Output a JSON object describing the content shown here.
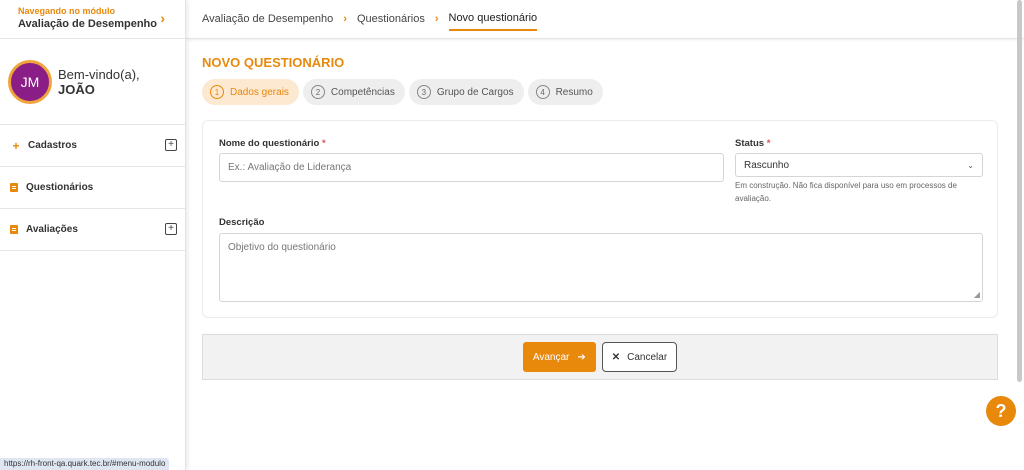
{
  "sidebar": {
    "module_small": "Navegando no módulo",
    "module_name": "Avaliação de Desempenho",
    "avatar_initials": "JM",
    "welcome": "Bem-vindo(a),",
    "user_name": "JOÃO",
    "items": [
      {
        "label": "Cadastros",
        "icon": "plus-icon",
        "expandable": true
      },
      {
        "label": "Questionários",
        "icon": "document-icon",
        "expandable": false
      },
      {
        "label": "Avaliações",
        "icon": "clipboard-icon",
        "expandable": true
      }
    ]
  },
  "status_url": "https://rh-front-qa.quark.tec.br/#menu-modulo",
  "breadcrumb": [
    "Avaliação de Desempenho",
    "Questionários",
    "Novo questionário"
  ],
  "page_title": "NOVO QUESTIONÁRIO",
  "steps": [
    {
      "num": "1",
      "label": "Dados gerais",
      "active": true
    },
    {
      "num": "2",
      "label": "Competências",
      "active": false
    },
    {
      "num": "3",
      "label": "Grupo de Cargos",
      "active": false
    },
    {
      "num": "4",
      "label": "Resumo",
      "active": false
    }
  ],
  "form": {
    "name_label": "Nome do questionário",
    "name_placeholder": "Ex.: Avaliação de Liderança",
    "status_label": "Status",
    "status_value": "Rascunho",
    "status_hint": "Em construção. Não fica disponível para uso em processos de avaliação.",
    "desc_label": "Descrição",
    "desc_placeholder": "Objetivo do questionário",
    "required_mark": "*"
  },
  "actions": {
    "next": "Avançar",
    "cancel": "Cancelar"
  },
  "help": "?",
  "colors": {
    "accent": "#e8890c",
    "avatar": "#8a1d86",
    "active_step_bg": "#fde8d2"
  }
}
